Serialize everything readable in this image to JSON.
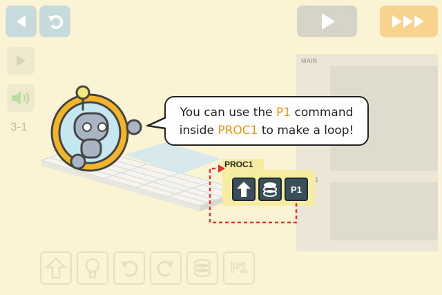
{
  "top_bar": {
    "back_icon": "left-triangle-icon",
    "undo_icon": "undo-arrow-icon",
    "play_icon": "play-triangle-icon",
    "fast_forward_icon": "fast-forward-icon"
  },
  "side_bar": {
    "run_icon": "play-triangle-icon",
    "sound_icon": "speaker-icon",
    "level_label": "3-1"
  },
  "program_panel": {
    "main_label": "MAIN",
    "proc_label_partial": "1"
  },
  "tutorial": {
    "bubble_prefix": "You can use the ",
    "bubble_p1": "P1",
    "bubble_mid": " command",
    "bubble_line2_prefix": "inside ",
    "bubble_proc1": "PROC1",
    "bubble_suffix": " to make a loop!",
    "proc_title": "PROC1",
    "commands": [
      {
        "name": "forward",
        "icon": "up-arrow-icon"
      },
      {
        "name": "light",
        "icon": "stack-icon"
      },
      {
        "name": "p1",
        "label": "P1"
      }
    ]
  },
  "bottom_commands": [
    {
      "name": "forward",
      "icon": "up-arrow-icon"
    },
    {
      "name": "light",
      "icon": "bulb-icon"
    },
    {
      "name": "turn-left",
      "icon": "rotate-left-icon"
    },
    {
      "name": "turn-right",
      "icon": "rotate-right-icon"
    },
    {
      "name": "jump",
      "icon": "stack-icon"
    },
    {
      "name": "p1",
      "label": "P1"
    }
  ],
  "colors": {
    "background": "#fbf4d4",
    "highlight": "#f0930b",
    "proc_box": "#f6eda2",
    "command": "#3a4f5a",
    "loop_arrow": "#e8312c"
  }
}
